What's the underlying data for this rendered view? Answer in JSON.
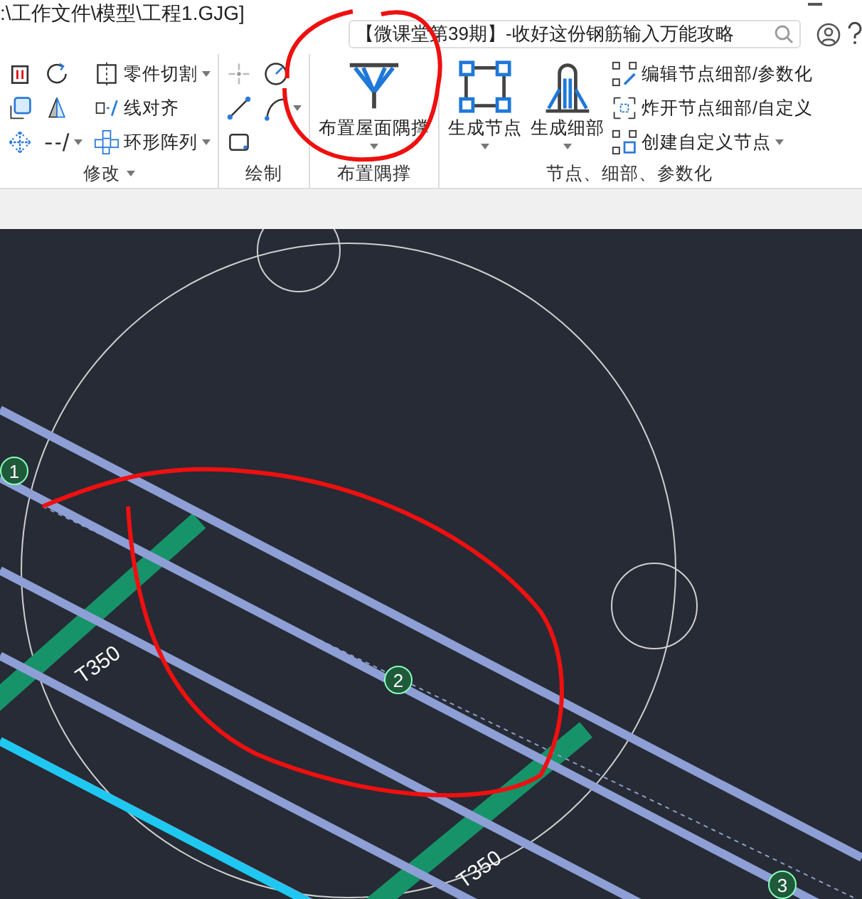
{
  "window": {
    "title": ":\\工作文件\\模型\\工程1.GJG]"
  },
  "search": {
    "value": "【微课堂第39期】-收好这份钢筋输入万能攻略"
  },
  "ribbon": {
    "groups": [
      {
        "label": "修改",
        "dropdown": true,
        "tools": [
          {
            "kind": "icon"
          },
          {
            "kind": "icon"
          },
          {
            "kind": "icon"
          },
          {
            "kind": "icon"
          },
          {
            "kind": "icon"
          },
          {
            "kind": "icon",
            "dropdown": true
          },
          {
            "kind": "small",
            "label": "零件切割",
            "dropdown": true
          },
          {
            "kind": "small",
            "label": "线对齐",
            "dropdown": false
          },
          {
            "kind": "small",
            "label": "环形阵列",
            "dropdown": true
          }
        ]
      },
      {
        "label": "绘制",
        "dropdown": false,
        "tools": [
          {
            "kind": "icon"
          },
          {
            "kind": "icon"
          },
          {
            "kind": "icon"
          },
          {
            "kind": "icon"
          },
          {
            "kind": "icon",
            "dropdown": true
          }
        ]
      },
      {
        "label": "布置隅撑",
        "dropdown": false,
        "tools": [
          {
            "kind": "big",
            "label": "布置屋面隅撑",
            "dropdown": true
          }
        ]
      },
      {
        "label": "节点、细部、参数化",
        "dropdown": false,
        "tools": [
          {
            "kind": "big",
            "label": "生成节点",
            "dropdown": true
          },
          {
            "kind": "big",
            "label": "生成细部",
            "dropdown": true
          },
          {
            "kind": "small",
            "label": "编辑节点细部/参数化",
            "dropdown": false
          },
          {
            "kind": "small",
            "label": "炸开节点细部/自定义",
            "dropdown": false
          },
          {
            "kind": "small",
            "label": "创建自定义节点",
            "dropdown": true
          }
        ]
      }
    ]
  },
  "viewport": {
    "nodes": [
      {
        "label": "1"
      },
      {
        "label": "2"
      },
      {
        "label": "3"
      }
    ],
    "member_labels": [
      "T350",
      "T350"
    ]
  }
}
